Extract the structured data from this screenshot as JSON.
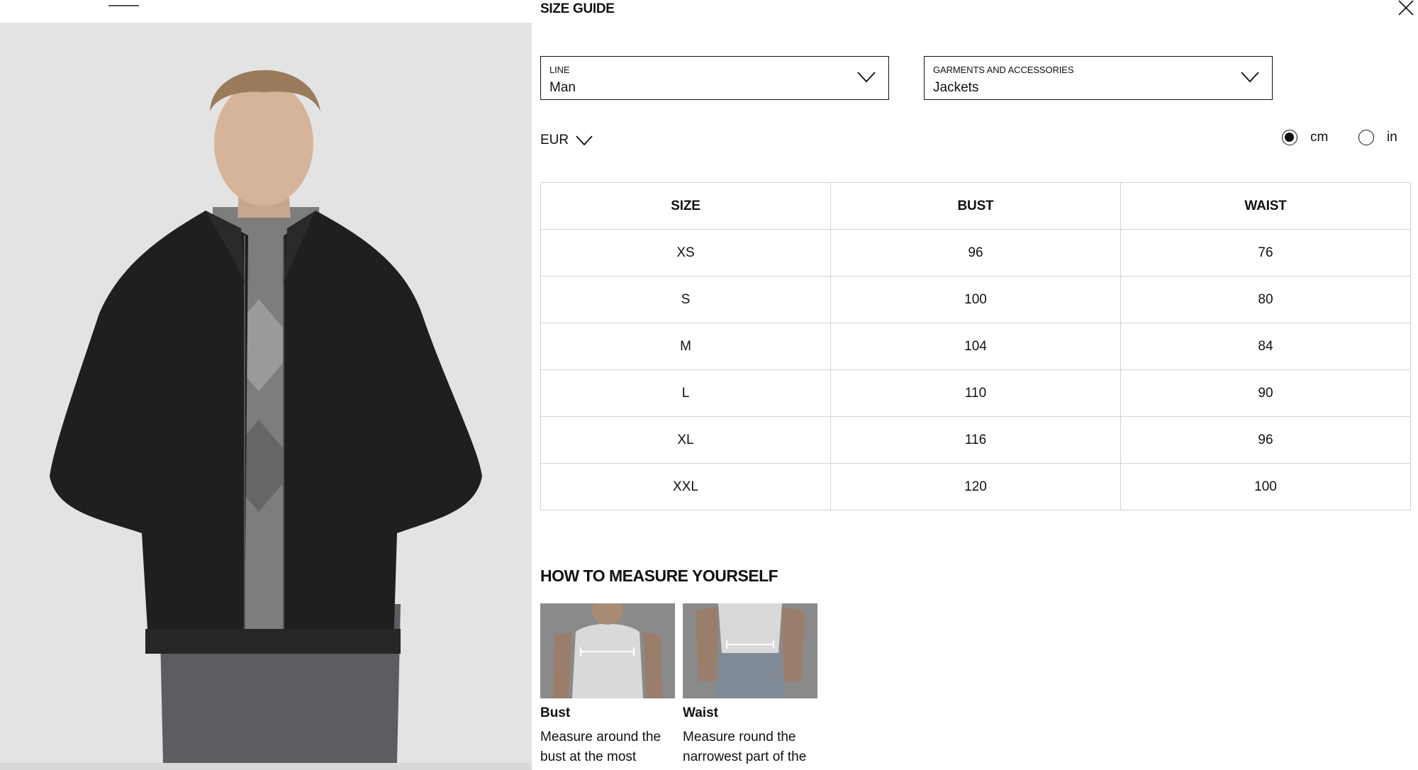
{
  "size_guide": {
    "title": "SIZE GUIDE",
    "close_icon": "close-icon",
    "line_select": {
      "label": "LINE",
      "value": "Man"
    },
    "category_select": {
      "label": "GARMENTS AND ACCESSORIES",
      "value": "Jackets"
    },
    "currency": "EUR",
    "units": [
      {
        "label": "cm",
        "selected": true
      },
      {
        "label": "in",
        "selected": false
      }
    ],
    "table": {
      "headers": [
        "SIZE",
        "BUST",
        "WAIST"
      ],
      "rows": [
        [
          "XS",
          "96",
          "76"
        ],
        [
          "S",
          "100",
          "80"
        ],
        [
          "M",
          "104",
          "84"
        ],
        [
          "L",
          "110",
          "90"
        ],
        [
          "XL",
          "116",
          "96"
        ],
        [
          "XXL",
          "120",
          "100"
        ]
      ]
    },
    "how_to_measure": {
      "title": "HOW TO MEASURE YOURSELF",
      "items": [
        {
          "name": "Bust",
          "description": "Measure around the bust at the most"
        },
        {
          "name": "Waist",
          "description": "Measure round the narrowest part of the"
        }
      ]
    }
  },
  "colors": {
    "photo_background": "#e3e3e3",
    "jacket": "#1f1f1f",
    "sweater": "#7a7a7a",
    "accent": "#111111",
    "table_border": "#d4d4d4"
  }
}
